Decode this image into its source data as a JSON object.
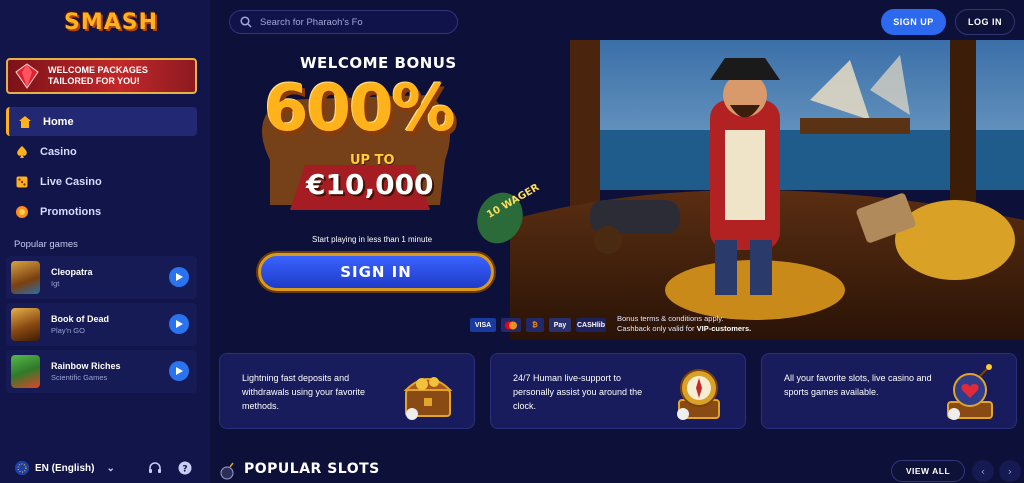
{
  "brand": {
    "logo": "SMASH"
  },
  "sidebar": {
    "promo": {
      "text": "WELCOME PACKAGES TAILORED FOR YOU!",
      "icon": "red-gem-icon"
    },
    "nav": [
      {
        "label": "Home",
        "icon": "home-icon",
        "active": true
      },
      {
        "label": "Casino",
        "icon": "spade-icon"
      },
      {
        "label": "Live Casino",
        "icon": "dice-icon"
      },
      {
        "label": "Promotions",
        "icon": "gift-icon"
      }
    ],
    "popular_label": "Popular games",
    "games": [
      {
        "name": "Cleopatra",
        "provider": "Igt"
      },
      {
        "name": "Book of Dead",
        "provider": "Play'n GO"
      },
      {
        "name": "Rainbow Riches",
        "provider": "Scientific Games"
      }
    ],
    "footer": {
      "language": "EN (English)",
      "icons": [
        "headset-icon",
        "help-icon"
      ]
    }
  },
  "header": {
    "search_placeholder": "Search for Pharaoh's Fo",
    "signup_label": "SIGN UP",
    "login_label": "LOG IN"
  },
  "hero": {
    "welcome": "WELCOME BONUS",
    "percent": "600%",
    "upto": "UP TO",
    "amount": "€10,000",
    "wager_tag": "10 WAGER",
    "start": "Start playing in less than 1 minute",
    "signin_label": "SIGN IN",
    "payments": [
      "VISA",
      "MC",
      "BTC",
      "Pay",
      "CASHlib"
    ],
    "terms_line1": "Bonus terms & conditions apply.",
    "terms_line2_pre": "Cashback only valid for ",
    "terms_line2_bold": "VIP-customers."
  },
  "features": [
    {
      "text": "Lightning fast deposits and withdrawals using your favorite methods.",
      "icon": "treasure-chest-icon"
    },
    {
      "text": "24/7 Human live-support to personally assist you around the clock.",
      "icon": "compass-icon"
    },
    {
      "text": "All your favorite slots, live casino and sports games available.",
      "icon": "bomb-heart-icon"
    }
  ],
  "popular_slots": {
    "title": "POPULAR SLOTS",
    "view_all": "VIEW ALL"
  },
  "colors": {
    "bg": "#0d1038",
    "sidebar": "#12154a",
    "accent_blue": "#2c69ee",
    "gold": "#ffb21e"
  }
}
